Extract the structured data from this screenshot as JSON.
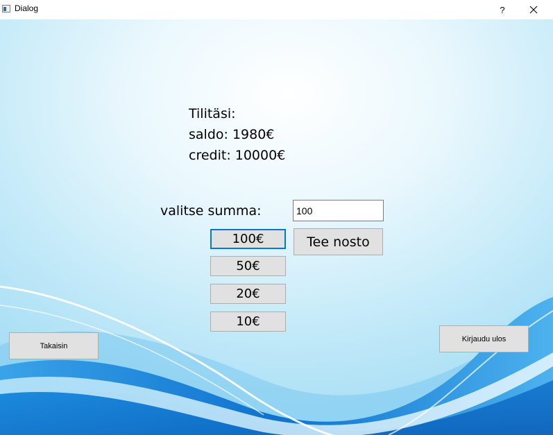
{
  "window": {
    "title": "Dialog",
    "help_label": "?",
    "close_icon": "close-icon"
  },
  "account": {
    "heading": "Tilitäsi:",
    "balance": "saldo: 1980€",
    "credit": "credit: 10000€"
  },
  "withdraw": {
    "select_label": "valitse summa:",
    "amount_value": "100",
    "amount_buttons": [
      "100€",
      "50€",
      "20€",
      "10€"
    ],
    "submit_label": "Tee nosto"
  },
  "nav": {
    "back_label": "Takaisin",
    "logout_label": "Kirjaudu ulos"
  },
  "colors": {
    "focus": "#0078d7",
    "button_bg": "#e1e1e1",
    "wave_blue": "#1683d8"
  }
}
